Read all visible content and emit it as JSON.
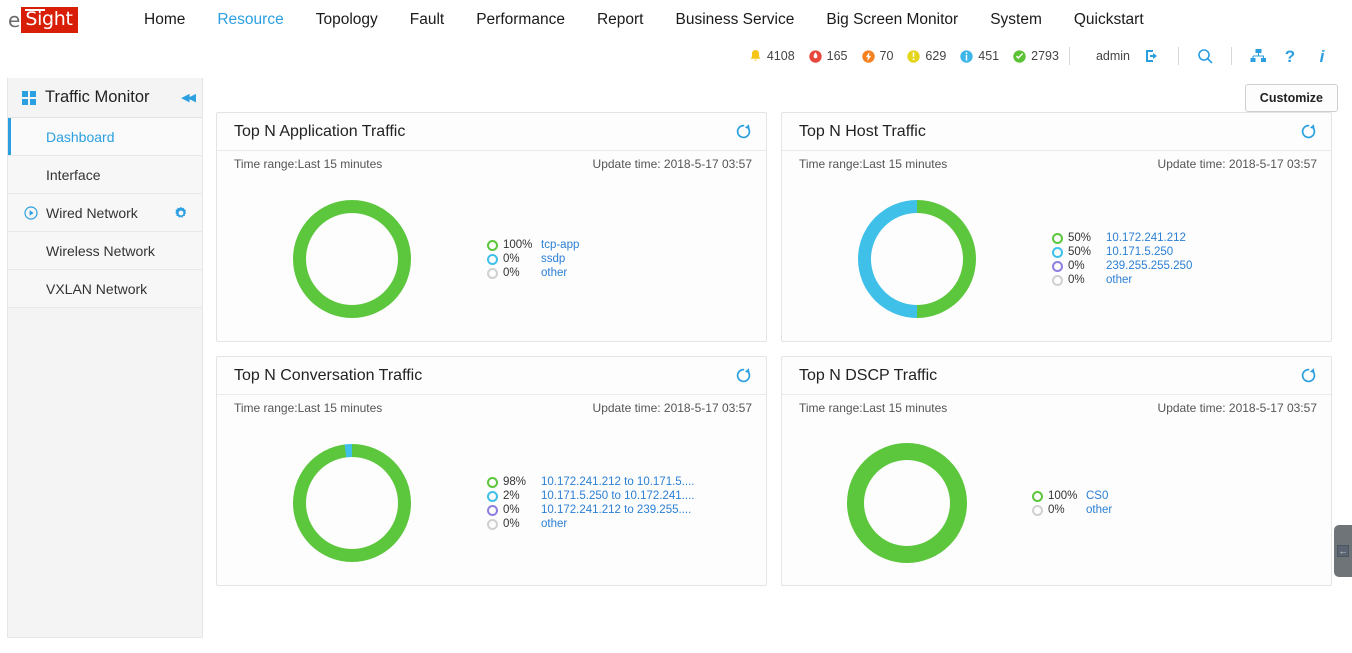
{
  "brand": {
    "prefix": "e",
    "boxed": "Sight"
  },
  "nav": {
    "items": [
      {
        "label": "Home",
        "active": false
      },
      {
        "label": "Resource",
        "active": true
      },
      {
        "label": "Topology",
        "active": false
      },
      {
        "label": "Fault",
        "active": false
      },
      {
        "label": "Performance",
        "active": false
      },
      {
        "label": "Report",
        "active": false
      },
      {
        "label": "Business Service",
        "active": false
      },
      {
        "label": "Big Screen Monitor",
        "active": false
      },
      {
        "label": "System",
        "active": false
      },
      {
        "label": "Quickstart",
        "active": false
      }
    ]
  },
  "status": {
    "counters": [
      {
        "icon": "bell-icon",
        "count": "4108",
        "color": "#f5c518"
      },
      {
        "icon": "critical-alarm-icon",
        "count": "165",
        "color": "#e8483c"
      },
      {
        "icon": "major-alarm-icon",
        "count": "70",
        "color": "#f58220"
      },
      {
        "icon": "minor-alarm-icon",
        "count": "629",
        "color": "#e5d51a"
      },
      {
        "icon": "info-alarm-icon",
        "count": "451",
        "color": "#3fb6e8"
      },
      {
        "icon": "cleared-alarm-icon",
        "count": "2793",
        "color": "#5bc236"
      }
    ],
    "user": "admin",
    "icons": [
      "logout-icon",
      "search-icon",
      "sitemap-icon",
      "help-icon",
      "about-icon"
    ]
  },
  "sidebar": {
    "title": "Traffic Monitor",
    "collapse_label": "◀◀",
    "items": [
      {
        "label": "Dashboard",
        "active": true,
        "lead_icon": "",
        "trail_icon": ""
      },
      {
        "label": "Interface",
        "active": false,
        "lead_icon": "",
        "trail_icon": ""
      },
      {
        "label": "Wired Network",
        "active": false,
        "lead_icon": "play-circle-icon",
        "trail_icon": "gear-icon"
      },
      {
        "label": "Wireless Network",
        "active": false,
        "lead_icon": "",
        "trail_icon": ""
      },
      {
        "label": "VXLAN Network",
        "active": false,
        "lead_icon": "",
        "trail_icon": ""
      }
    ]
  },
  "toolbar": {
    "customize_label": "Customize"
  },
  "colors": {
    "green": "#5cc63d",
    "blue": "#3fc0e8",
    "purple": "#8d7fe0",
    "gray": "#d0d0d0",
    "link": "#2b7fd4",
    "accent": "#2b9fe0"
  },
  "cards": [
    {
      "title": "Top N Application Traffic",
      "time_range": "Time range:Last 15 minutes",
      "update_time": "Update time: 2018-5-17 03:57",
      "refresh_icon": "refresh-icon",
      "chart_data": {
        "type": "pie",
        "title": "Top N Application Traffic",
        "categories": [
          "tcp-app",
          "ssdp",
          "other"
        ],
        "values": [
          100,
          0,
          0
        ],
        "labels": [
          "100%",
          "0%",
          "0%"
        ],
        "colors": [
          "#5cc63d",
          "#3fc0e8",
          "#d0d0d0"
        ],
        "donut": true,
        "legend": "right"
      }
    },
    {
      "title": "Top N Host Traffic",
      "time_range": "Time range:Last 15 minutes",
      "update_time": "Update time: 2018-5-17 03:57",
      "refresh_icon": "refresh-icon",
      "chart_data": {
        "type": "pie",
        "title": "Top N Host Traffic",
        "categories": [
          "10.172.241.212",
          "10.171.5.250",
          "239.255.255.250",
          "other"
        ],
        "values": [
          50,
          50,
          0,
          0
        ],
        "labels": [
          "50%",
          "50%",
          "0%",
          "0%"
        ],
        "colors": [
          "#5cc63d",
          "#3fc0e8",
          "#8d7fe0",
          "#d0d0d0"
        ],
        "donut": true,
        "legend": "right"
      }
    },
    {
      "title": "Top N Conversation Traffic",
      "time_range": "Time range:Last 15 minutes",
      "update_time": "Update time: 2018-5-17 03:57",
      "refresh_icon": "refresh-icon",
      "chart_data": {
        "type": "pie",
        "title": "Top N Conversation Traffic",
        "categories": [
          "10.172.241.212 to 10.171.5....",
          "10.171.5.250 to 10.172.241....",
          "10.172.241.212 to 239.255....",
          "other"
        ],
        "values": [
          98,
          2,
          0,
          0
        ],
        "labels": [
          "98%",
          "2%",
          "0%",
          "0%"
        ],
        "colors": [
          "#5cc63d",
          "#3fc0e8",
          "#8d7fe0",
          "#d0d0d0"
        ],
        "donut": true,
        "legend": "right"
      }
    },
    {
      "title": "Top N DSCP Traffic",
      "time_range": "Time range:Last 15 minutes",
      "update_time": "Update time: 2018-5-17 03:57",
      "refresh_icon": "refresh-icon",
      "chart_data": {
        "type": "pie",
        "title": "Top N DSCP Traffic",
        "categories": [
          "CS0",
          "other"
        ],
        "values": [
          100,
          0
        ],
        "labels": [
          "100%",
          "0%"
        ],
        "colors": [
          "#5cc63d",
          "#d0d0d0"
        ],
        "donut": true,
        "legend": "right"
      }
    }
  ],
  "edge_tab": {
    "icon": "collapse-left-icon",
    "glyph": "←"
  }
}
